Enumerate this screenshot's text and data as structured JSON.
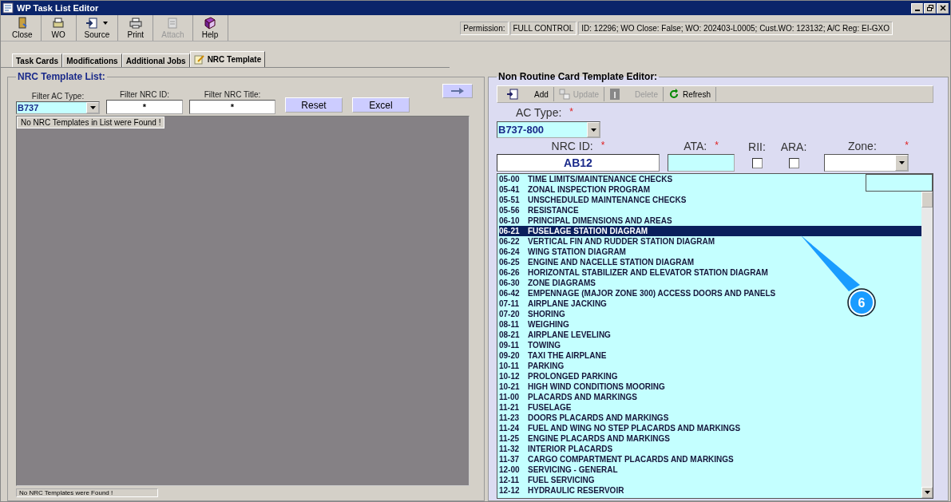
{
  "window": {
    "title": "WP Task List Editor"
  },
  "toolbar": [
    {
      "label": "Close",
      "disabled": false,
      "dropdown": false
    },
    {
      "label": "WO",
      "disabled": false,
      "dropdown": false
    },
    {
      "label": "Source",
      "disabled": false,
      "dropdown": true
    },
    {
      "label": "Print",
      "disabled": false,
      "dropdown": false
    },
    {
      "label": "Attach",
      "disabled": true,
      "dropdown": false
    },
    {
      "label": "Help",
      "disabled": false,
      "dropdown": false
    }
  ],
  "status": {
    "permission_label": "Permission:",
    "permission_value": "FULL CONTROL",
    "info": "ID: 12296; WO Close: False; WO: 202403-L0005; Cust.WO: 123132; A/C Reg: EI-GXO"
  },
  "tabs": [
    {
      "label": "Task Cards",
      "selected": false
    },
    {
      "label": "Modifications",
      "selected": false
    },
    {
      "label": "Additional Jobs",
      "selected": false
    },
    {
      "label": "NRC Template",
      "selected": true
    }
  ],
  "template_list": {
    "title": "NRC Template List:",
    "filters": [
      {
        "label": "Filter AC Type:",
        "value": "B737",
        "kind": "dropdown"
      },
      {
        "label": "Filter NRC ID:",
        "value": "*",
        "kind": "text"
      },
      {
        "label": "Filter NRC Title:",
        "value": "*",
        "kind": "text"
      }
    ],
    "buttons": [
      "Reset",
      "Excel"
    ],
    "message": "No NRC Templates in List were Found !",
    "status": "No NRC Templates were Found !"
  },
  "editor": {
    "title": "Non Routine Card Template Editor:",
    "toolbar": [
      {
        "label": "Add",
        "disabled": false
      },
      {
        "label": "Update",
        "disabled": true
      },
      {
        "label": "Delete",
        "disabled": true
      },
      {
        "label": "Refresh",
        "disabled": false
      }
    ],
    "ac_type": {
      "label": "AC Type:",
      "required_mark": "*",
      "value": "B737-800"
    },
    "nrc_id": {
      "label": "NRC ID:",
      "required_mark": "*",
      "value": "AB12"
    },
    "ata": {
      "label": "ATA:",
      "required_mark": "*"
    },
    "rii": {
      "label": "RII:",
      "checked": false
    },
    "ara": {
      "label": "ARA:",
      "checked": false
    },
    "zone": {
      "label": "Zone:",
      "required_mark": "*"
    },
    "ata_list": [
      {
        "code": "05-00",
        "title": "TIME LIMITS/MAINTENANCE CHECKS",
        "selected": false
      },
      {
        "code": "05-41",
        "title": "ZONAL INSPECTION PROGRAM",
        "selected": false
      },
      {
        "code": "05-51",
        "title": "UNSCHEDULED MAINTENANCE CHECKS",
        "selected": false
      },
      {
        "code": "05-56",
        "title": "RESISTANCE",
        "selected": false
      },
      {
        "code": "06-10",
        "title": "PRINCIPAL DIMENSIONS AND AREAS",
        "selected": false
      },
      {
        "code": "06-21",
        "title": "FUSELAGE STATION DIAGRAM",
        "selected": true
      },
      {
        "code": "06-22",
        "title": "VERTICAL FIN AND RUDDER STATION DIAGRAM",
        "selected": false
      },
      {
        "code": "06-24",
        "title": "WING STATION DIAGRAM",
        "selected": false
      },
      {
        "code": "06-25",
        "title": "ENGINE AND NACELLE STATION DIAGRAM",
        "selected": false
      },
      {
        "code": "06-26",
        "title": "HORIZONTAL STABILIZER AND ELEVATOR STATION DIAGRAM",
        "selected": false
      },
      {
        "code": "06-30",
        "title": "ZONE DIAGRAMS",
        "selected": false
      },
      {
        "code": "06-42",
        "title": "EMPENNAGE (MAJOR ZONE 300) ACCESS DOORS AND PANELS",
        "selected": false
      },
      {
        "code": "07-11",
        "title": "AIRPLANE JACKING",
        "selected": false
      },
      {
        "code": "07-20",
        "title": "SHORING",
        "selected": false
      },
      {
        "code": "08-11",
        "title": "WEIGHING",
        "selected": false
      },
      {
        "code": "08-21",
        "title": "AIRPLANE LEVELING",
        "selected": false
      },
      {
        "code": "09-11",
        "title": "TOWING",
        "selected": false
      },
      {
        "code": "09-20",
        "title": "TAXI THE AIRPLANE",
        "selected": false
      },
      {
        "code": "10-11",
        "title": "PARKING",
        "selected": false
      },
      {
        "code": "10-12",
        "title": "PROLONGED PARKING",
        "selected": false
      },
      {
        "code": "10-21",
        "title": "HIGH WIND CONDITIONS MOORING",
        "selected": false
      },
      {
        "code": "11-00",
        "title": "PLACARDS AND MARKINGS",
        "selected": false
      },
      {
        "code": "11-21",
        "title": "FUSELAGE",
        "selected": false
      },
      {
        "code": "11-23",
        "title": "DOORS PLACARDS AND MARKINGS",
        "selected": false
      },
      {
        "code": "11-24",
        "title": "FUEL AND WING NO STEP PLACARDS AND MARKINGS",
        "selected": false
      },
      {
        "code": "11-25",
        "title": "ENGINE PLACARDS AND MARKINGS",
        "selected": false
      },
      {
        "code": "11-32",
        "title": "INTERIOR PLACARDS",
        "selected": false
      },
      {
        "code": "11-37",
        "title": "CARGO COMPARTMENT PLACARDS AND MARKINGS",
        "selected": false
      },
      {
        "code": "12-00",
        "title": "SERVICING - GENERAL",
        "selected": false
      },
      {
        "code": "12-11",
        "title": "FUEL SERVICING",
        "selected": false
      },
      {
        "code": "12-12",
        "title": "HYDRAULIC RESERVOIR",
        "selected": false
      }
    ]
  },
  "callout": {
    "label": "6"
  }
}
